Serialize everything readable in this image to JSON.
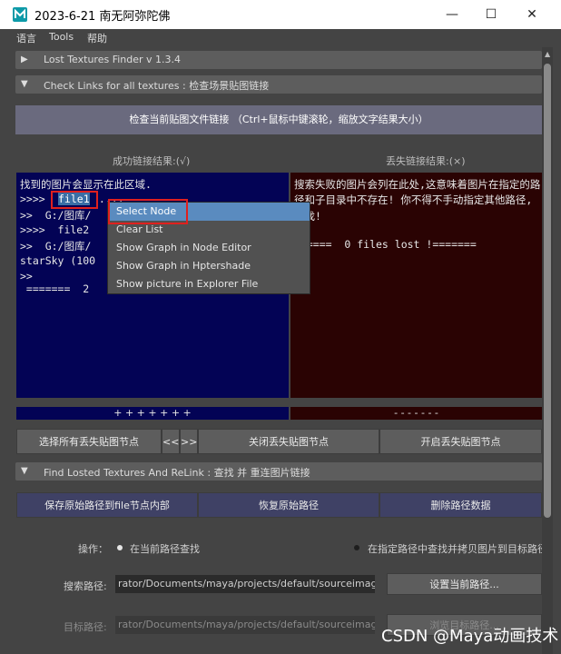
{
  "window": {
    "title": "2023-6-21  南无阿弥陀佛",
    "minimize": "—",
    "maximize": "☐",
    "close": "✕"
  },
  "menu": [
    "语言",
    "Tools",
    "帮助"
  ],
  "frames": {
    "finder": "Lost Textures Finder  v 1.3.4",
    "check": "Check Links for all textures : 检查场景贴图链接",
    "find": "Find Losted Textures  And  ReLink : 查找 并 重连图片链接"
  },
  "check_button": "检查当前贴图文件链接  （Ctrl+鼠标中键滚轮，缩放文字结果大小）",
  "success_header": "成功链接结果:(√)",
  "lost_header": "丢失链接结果:(×)",
  "left_lines": [
    "找到的图片会显示在此区域.",
    ">>>> ",
    "file1",
    " ....",
    ">>  G:/图库/",
    ">>>>  file2",
    ">>  G:/图库/",
    "starSky (100",
    ">>",
    " =======  2"
  ],
  "right_lines": [
    "搜索失败的图片会列在此处,这意味着图片在指定的路",
    "径和子目录中不存在! 你不得不手动指定其他路径,",
    "查找!",
    "======  0 files lost !======="
  ],
  "context_menu": [
    "Select Node",
    "Clear List",
    "Show Graph in Node Editor",
    "Show Graph in Hptershade",
    "Show picture in Explorer File"
  ],
  "strip_left": "+ + + + + + +",
  "strip_right": "- - - - - - -",
  "row_buttons": {
    "select_lost": "选择所有丢失贴图节点",
    "prev": "<<",
    "next": ">>",
    "close_lost": "关闭丢失贴图节点",
    "open_lost": "开启丢失贴图节点"
  },
  "path_buttons": {
    "save": "保存原始路径到file节点内部",
    "restore": "恢复原始路径",
    "delete": "删除路径数据"
  },
  "operation": {
    "label": "操作：",
    "opt1": "在当前路径查找",
    "opt2": "在指定路径中查找并拷贝图片到目标路径"
  },
  "search_path": {
    "label": "搜索路径:",
    "value": "rator/Documents/maya/projects/default/sourceimages/",
    "button": "设置当前路径..."
  },
  "target_path": {
    "label": "目标路径:",
    "value": "rator/Documents/maya/projects/default/sourceimages/",
    "button": "浏览目标路径..."
  },
  "watermark": "CSDN @Maya动画技术",
  "colors": {
    "left_panel": "#030355",
    "right_panel": "#2a0303",
    "highlight": "#e0201e",
    "menu_active": "#5a8bbf"
  }
}
